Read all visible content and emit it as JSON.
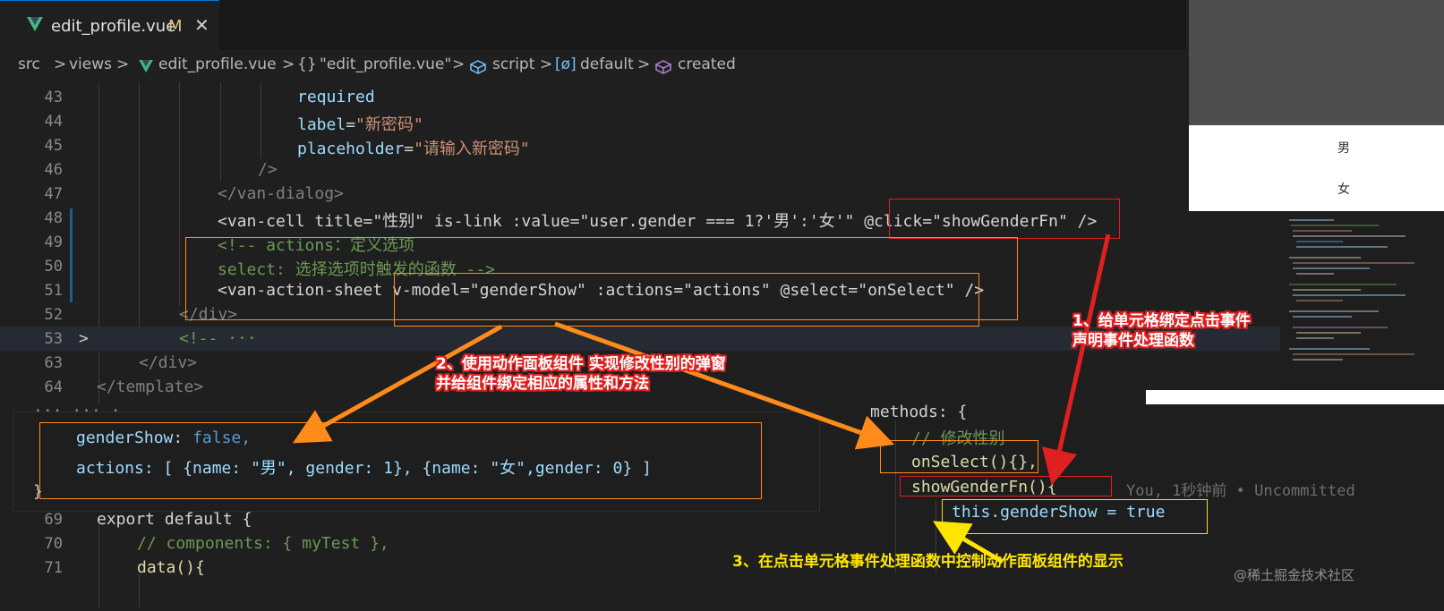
{
  "tab": {
    "filename": "edit_profile.vue",
    "modified": "M",
    "close": "✕",
    "vue_icon": "V"
  },
  "breadcrumb": [
    "src",
    ">",
    "views",
    ">",
    "edit_profile.vue",
    ">",
    "{}",
    "\"edit_profile.vue\"",
    ">",
    "script",
    ">",
    "[ø]",
    "default",
    ">",
    "created"
  ],
  "code_lines": [
    {
      "n": "43",
      "text": "required"
    },
    {
      "n": "44",
      "attr": "label",
      "eq": "=",
      "val": "\"新密码\""
    },
    {
      "n": "45",
      "attr": "placeholder",
      "eq": "=",
      "val": "\"请输入新密码\""
    },
    {
      "n": "46",
      "text": "/>"
    },
    {
      "n": "47",
      "text": "</van-dialog>"
    },
    {
      "n": "48",
      "text": "<van-cell title=\"性别\" is-link :value=\"user.gender === 1?'男':'女'\" @click=\"showGenderFn\" />"
    },
    {
      "n": "49",
      "text": "<!-- actions：定义选项"
    },
    {
      "n": "50",
      "text": "select: 选择选项时触发的函数 -->"
    },
    {
      "n": "51",
      "text": "<van-action-sheet v-model=\"genderShow\" :actions=\"actions\" @select=\"onSelect\" />"
    },
    {
      "n": "52",
      "text": "</div>"
    },
    {
      "n": "53",
      "text": "<!-- ···"
    },
    {
      "n": "63",
      "text": "</div>"
    },
    {
      "n": "64",
      "text": "</template>"
    },
    {
      "n": "69",
      "text": "export default {"
    },
    {
      "n": "70",
      "text": "// components: { myTest },"
    },
    {
      "n": "71",
      "text": "data(){"
    }
  ],
  "data_panel": {
    "line1_key": "genderShow",
    "line1_val": "false,",
    "line2": "actions: [ {name: \"男\", gender: 1}, {name: \"女\",gender: 0} ]",
    "brace": "}"
  },
  "methods_panel": {
    "l1": "methods: {",
    "l2": "// 修改性别",
    "l3": "onSelect(){},",
    "l4": "showGenderFn(){",
    "l5": "this.genderShow = true",
    "blame": "You, 1秒钟前 • Uncommitted"
  },
  "action_sheet_preview": {
    "options": [
      "男",
      "女"
    ]
  },
  "annotations": {
    "a1_line1": "1、给单元格绑定点击事件",
    "a1_line2": "声明事件处理函数",
    "a2_line1": "2、使用动作面板组件 实现修改性别的弹窗",
    "a2_line2": "并给组件绑定相应的属性和方法",
    "a3": "3、在点击单元格事件处理函数中控制动作面板组件的显示"
  },
  "watermark": "@稀土掘金技术社区",
  "colors": {
    "orange": "#ff8c1a",
    "red": "#e02020",
    "yellow": "#ffe600"
  }
}
